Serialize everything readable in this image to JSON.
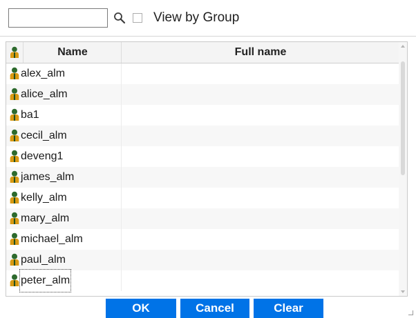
{
  "toolbar": {
    "search_value": "",
    "search_placeholder": "",
    "view_by_group_label": "View by Group",
    "view_by_group_checked": false
  },
  "grid": {
    "columns": [
      "Name",
      "Full name"
    ],
    "rows": [
      {
        "name": "alex_alm",
        "full_name": ""
      },
      {
        "name": "alice_alm",
        "full_name": ""
      },
      {
        "name": "ba1",
        "full_name": ""
      },
      {
        "name": "cecil_alm",
        "full_name": ""
      },
      {
        "name": "deveng1",
        "full_name": ""
      },
      {
        "name": "james_alm",
        "full_name": ""
      },
      {
        "name": "kelly_alm",
        "full_name": ""
      },
      {
        "name": "mary_alm",
        "full_name": ""
      },
      {
        "name": "michael_alm",
        "full_name": ""
      },
      {
        "name": "paul_alm",
        "full_name": ""
      },
      {
        "name": "peter_alm",
        "full_name": ""
      }
    ]
  },
  "buttons": {
    "ok": "OK",
    "cancel": "Cancel",
    "clear": "Clear"
  },
  "colors": {
    "button_bg": "#0073e7",
    "icon_body": "#d99a12",
    "icon_head": "#2d6a2d"
  }
}
